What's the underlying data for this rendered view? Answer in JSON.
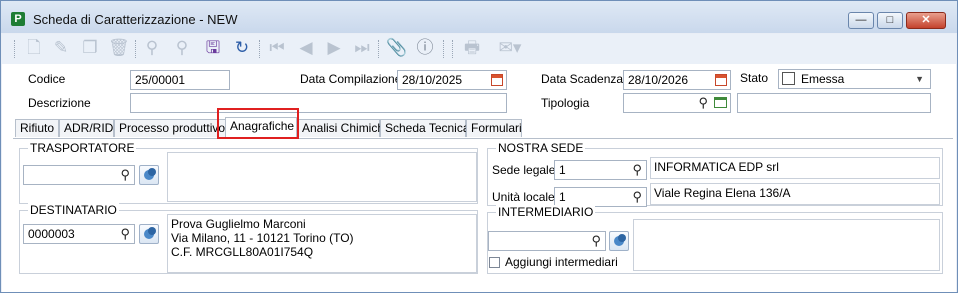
{
  "window": {
    "title": "Scheda di Caratterizzazione - NEW",
    "app_icon": "P",
    "controls": {
      "minimize": "—",
      "maximize": "□",
      "close": "✕"
    }
  },
  "toolbar": {
    "icons": [
      "new-document-icon",
      "edit-pencil-icon",
      "copy-icon",
      "delete-trash-icon",
      "search-icon",
      "search-plus-icon",
      "save-icon",
      "refresh-icon",
      "first-record-icon",
      "previous-record-icon",
      "next-record-icon",
      "last-record-icon",
      "attachment-icon",
      "info-icon",
      "print-icon",
      "email-icon"
    ]
  },
  "header": {
    "codice_label": "Codice",
    "codice_value": "25/00001",
    "data_compilazione_label": "Data Compilazione",
    "data_compilazione_value": "28/10/2025",
    "data_scadenza_label": "Data Scadenza",
    "data_scadenza_value": "28/10/2026",
    "stato_label": "Stato",
    "stato_value": "Emessa",
    "descrizione_label": "Descrizione",
    "descrizione_value": "",
    "tipologia_label": "Tipologia",
    "tipologia_value": ""
  },
  "tabs": [
    "Rifiuto",
    "ADR/RID",
    "Processo produttivo",
    "Anagrafiche",
    "Analisi Chimiche",
    "Scheda Tecnica",
    "Formulari"
  ],
  "selected_tab": "Anagrafiche",
  "anagrafiche": {
    "trasportatore": {
      "title": "TRASPORTATORE",
      "code": "",
      "details": ""
    },
    "destinatario": {
      "title": "DESTINATARIO",
      "code": "0000003",
      "line1": "Prova Guglielmo Marconi",
      "line2": "Via Milano, 11 - 10121 Torino (TO)",
      "line3": "C.F. MRCGLL80A01I754Q"
    },
    "nostra_sede": {
      "title": "NOSTRA SEDE",
      "sede_legale_label": "Sede legale",
      "sede_legale_code": "1",
      "sede_legale_name": "INFORMATICA EDP srl",
      "unita_locale_label": "Unità locale",
      "unita_locale_code": "1",
      "unita_locale_address": "Viale Regina Elena 136/A"
    },
    "intermediario": {
      "title": "INTERMEDIARIO",
      "code": "",
      "checkbox_label": "Aggiungi intermediari",
      "checkbox_checked": false
    }
  },
  "colors": {
    "highlight": "#e02020",
    "title_bar": "#c9d8ec",
    "save_icon": "#6a3a9c",
    "refresh_icon": "#2e5ea8"
  }
}
